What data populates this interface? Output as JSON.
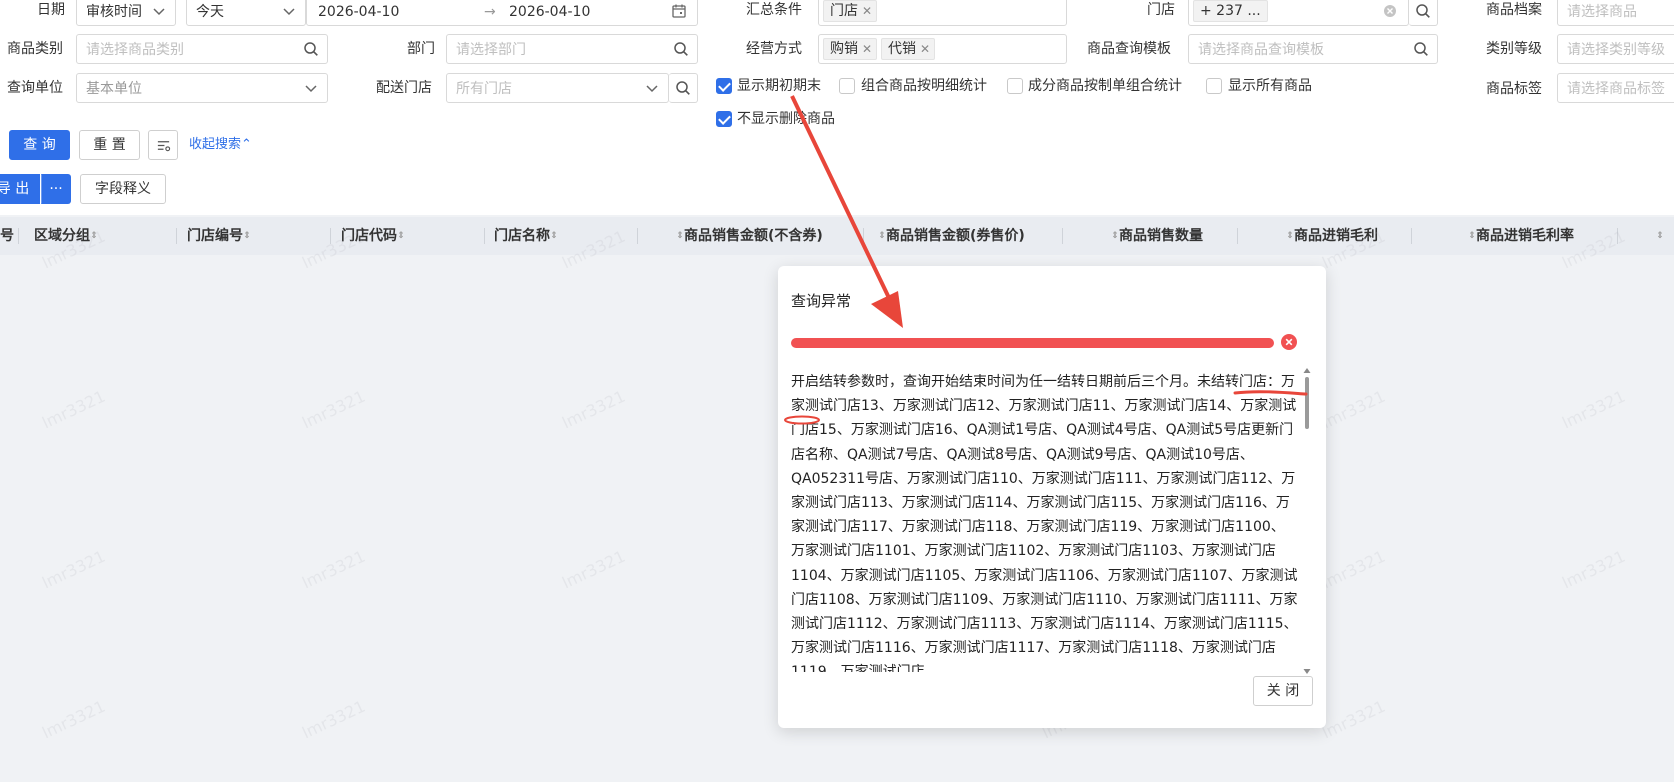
{
  "filters": {
    "date_label": "日期",
    "date_type": "审核时间",
    "date_preset": "今天",
    "date_start": "2026-04-10",
    "date_end": "2026-04-10",
    "summary_label": "汇总条件",
    "summary_tag": "门店",
    "store_label": "门店",
    "store_value": "+ 237 ...",
    "product_label": "商品档案",
    "product_placeholder": "请选择商品",
    "category_label": "商品类别",
    "category_placeholder": "请选择商品类别",
    "dept_label": "部门",
    "dept_placeholder": "请选择部门",
    "mode_label": "经营方式",
    "mode_tags": [
      "购销",
      "代销"
    ],
    "template_label": "商品查询模板",
    "template_placeholder": "请选择商品查询模板",
    "level_label": "类别等级",
    "level_placeholder": "请选择类别等级",
    "unit_label": "查询单位",
    "unit_value": "基本单位",
    "delivery_label": "配送门店",
    "delivery_placeholder": "所有门店",
    "tag_label": "商品标签",
    "tag_placeholder": "请选择商品标签"
  },
  "checkboxes": [
    {
      "label": "显示期初期末",
      "checked": true
    },
    {
      "label": "组合商品按明细统计",
      "checked": false
    },
    {
      "label": "成分商品按制单组合统计",
      "checked": false
    },
    {
      "label": "显示所有商品",
      "checked": false
    },
    {
      "label": "不显示删除商品",
      "checked": true
    }
  ],
  "actions": {
    "query": "查 询",
    "reset": "重 置",
    "collapse": "收起搜索",
    "export": "导 出",
    "more": "···",
    "fields": "字段释义"
  },
  "table": {
    "columns": [
      "号",
      "区域分组",
      "门店编号",
      "门店代码",
      "门店名称",
      "商品销售金额(不含券)",
      "商品销售金额(券售价)",
      "商品销售数量",
      "商品进销毛利",
      "商品进销毛利率"
    ]
  },
  "watermark_text": "lmr3321",
  "modal": {
    "title": "查询异常",
    "message": "开启结转参数时，查询开始结束时间为任一结转日期前后三个月。未结转门店：万家测试门店13、万家测试门店12、万家测试门店11、万家测试门店14、万家测试门店15、万家测试门店16、QA测试1号店、QA测试4号店、QA测试5号店更新门店名称、QA测试7号店、QA测试8号店、QA测试9号店、QA测试10号店、QA052311号店、万家测试门店110、万家测试门店111、万家测试门店112、万家测试门店113、万家测试门店114、万家测试门店115、万家测试门店116、万家测试门店117、万家测试门店118、万家测试门店119、万家测试门店1100、万家测试门店1101、万家测试门店1102、万家测试门店1103、万家测试门店1104、万家测试门店1105、万家测试门店1106、万家测试门店1107、万家测试门店1108、万家测试门店1109、万家测试门店1110、万家测试门店1111、万家测试门店1112、万家测试门店1113、万家测试门店1114、万家测试门店1115、万家测试门店1116、万家测试门店1117、万家测试门店1118、万家测试门店1119、万家测试门店",
    "close": "关 闭"
  },
  "colors": {
    "primary": "#2f6fe8",
    "error": "#f15152",
    "annotation": "#e8463a"
  }
}
